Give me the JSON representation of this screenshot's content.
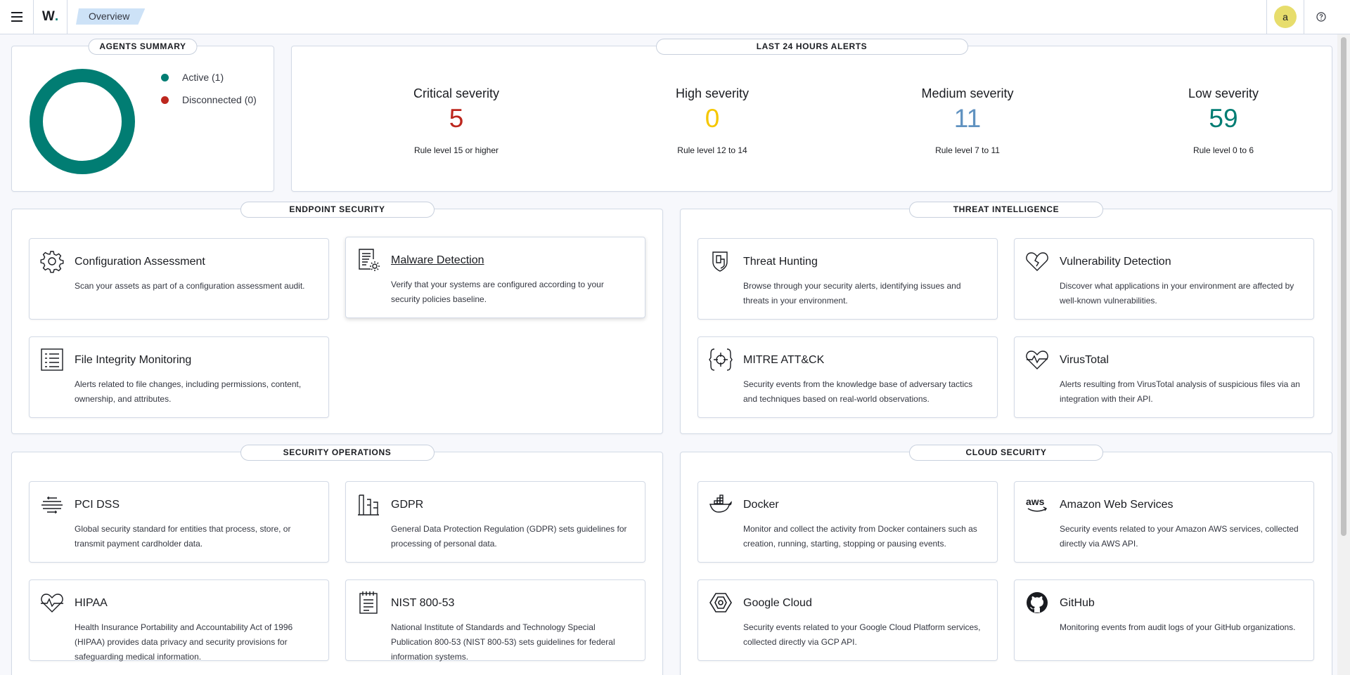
{
  "header": {
    "logo": "W",
    "logo_dot": ".",
    "breadcrumb": "Overview",
    "avatar_letter": "a",
    "icons": [
      "menu-icon",
      "help-icon"
    ]
  },
  "agents_summary": {
    "title": "AGENTS SUMMARY",
    "legend": [
      {
        "label": "Active (1)",
        "color": "#017d73"
      },
      {
        "label": "Disconnected (0)",
        "color": "#bd271e"
      }
    ]
  },
  "alerts": {
    "title": "LAST 24 HOURS ALERTS",
    "items": [
      {
        "title": "Critical severity",
        "value": "5",
        "sub": "Rule level 15 or higher",
        "color": "#bd271e"
      },
      {
        "title": "High severity",
        "value": "0",
        "sub": "Rule level 12 to 14",
        "color": "#f5c700"
      },
      {
        "title": "Medium severity",
        "value": "11",
        "sub": "Rule level 7 to 11",
        "color": "#6092c0"
      },
      {
        "title": "Low severity",
        "value": "59",
        "sub": "Rule level 0 to 6",
        "color": "#017d73"
      }
    ]
  },
  "sections": {
    "endpoint": {
      "title": "ENDPOINT SECURITY",
      "cards": [
        {
          "title": "Configuration Assessment",
          "desc": "Scan your assets as part of a configuration assessment audit.",
          "icon": "gear-icon"
        },
        {
          "title": "Malware Detection",
          "desc": "Verify that your systems are configured according to your security policies baseline.",
          "icon": "document-gear-icon"
        },
        {
          "title": "File Integrity Monitoring",
          "desc": "Alerts related to file changes, including permissions, content, ownership, and attributes.",
          "icon": "list-document-icon"
        }
      ]
    },
    "threat": {
      "title": "THREAT INTELLIGENCE",
      "cards": [
        {
          "title": "Threat Hunting",
          "desc": "Browse through your security alerts, identifying issues and threats in your environment.",
          "icon": "shield-icon"
        },
        {
          "title": "Vulnerability Detection",
          "desc": "Discover what applications in your environment are affected by well-known vulnerabilities.",
          "icon": "broken-heart-icon"
        },
        {
          "title": "MITRE ATT&CK",
          "desc": "Security events from the knowledge base of adversary tactics and techniques based on real-world observations.",
          "icon": "crosshair-icon"
        },
        {
          "title": "VirusTotal",
          "desc": "Alerts resulting from VirusTotal analysis of suspicious files via an integration with their API.",
          "icon": "heart-pulse-icon"
        }
      ]
    },
    "secops": {
      "title": "SECURITY OPERATIONS",
      "cards": [
        {
          "title": "PCI DSS",
          "desc": "Global security standard for entities that process, store, or transmit payment cardholder data.",
          "icon": "pci-icon"
        },
        {
          "title": "GDPR",
          "desc": "General Data Protection Regulation (GDPR) sets guidelines for processing of personal data.",
          "icon": "bank-icon"
        },
        {
          "title": "HIPAA",
          "desc": "Health Insurance Portability and Accountability Act of 1996 (HIPAA) provides data privacy and security provisions for safeguarding medical information.",
          "icon": "heartbeat-icon"
        },
        {
          "title": "NIST 800-53",
          "desc": "National Institute of Standards and Technology Special Publication 800-53 (NIST 800-53) sets guidelines for federal information systems.",
          "icon": "notebook-icon"
        }
      ]
    },
    "cloud": {
      "title": "CLOUD SECURITY",
      "cards": [
        {
          "title": "Docker",
          "desc": "Monitor and collect the activity from Docker containers such as creation, running, starting, stopping or pausing events.",
          "icon": "docker-icon"
        },
        {
          "title": "Amazon Web Services",
          "desc": "Security events related to your Amazon AWS services, collected directly via AWS API.",
          "icon": "aws-icon"
        },
        {
          "title": "Google Cloud",
          "desc": "Security events related to your Google Cloud Platform services, collected directly via GCP API.",
          "icon": "google-cloud-icon"
        },
        {
          "title": "GitHub",
          "desc": "Monitoring events from audit logs of your GitHub organizations.",
          "icon": "github-icon"
        }
      ]
    }
  }
}
